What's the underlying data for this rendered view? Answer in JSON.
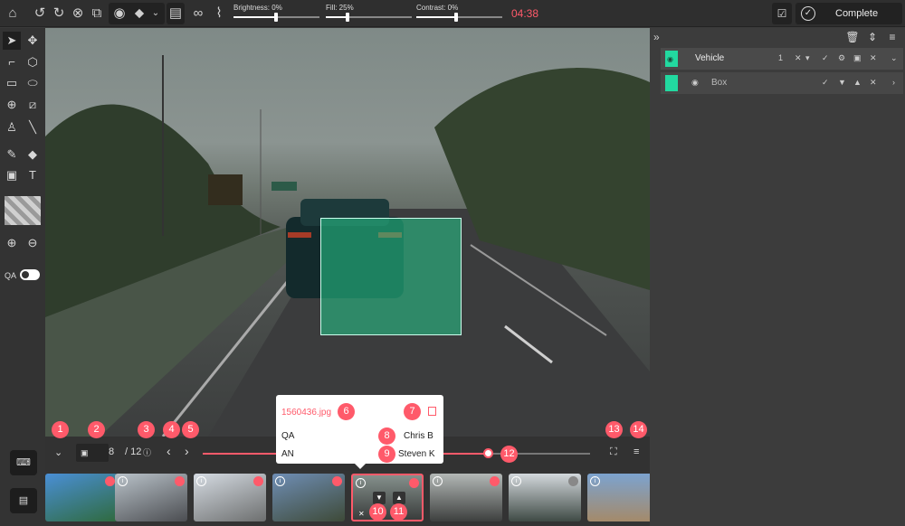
{
  "toolbar": {
    "brightness_label": "Brightness: 0%",
    "brightness_value": 0,
    "fill_label": "Fill: 25%",
    "fill_value": 25,
    "contrast_label": "Contrast: 0%",
    "contrast_value": 0,
    "timer": "04:38",
    "complete_label": "Complete",
    "accent_color": "#ff5a6a"
  },
  "left_toolbar": {
    "qa_label": "QA"
  },
  "classes_panel": {
    "class_name": "Vehicle",
    "class_count": "1",
    "class_color": "#22d9a0",
    "annotation_type": "Box"
  },
  "navigation": {
    "current_page": "8",
    "total_pages": "/ 12",
    "progress": 0.66
  },
  "popup": {
    "filename": "1560436.jpg",
    "qa_label": "QA",
    "qa_user": "Chris B",
    "an_label": "AN",
    "an_user": "Steven K"
  },
  "callouts": [
    "1",
    "2",
    "3",
    "4",
    "5",
    "6",
    "7",
    "8",
    "9",
    "10",
    "11",
    "12",
    "13",
    "14"
  ]
}
